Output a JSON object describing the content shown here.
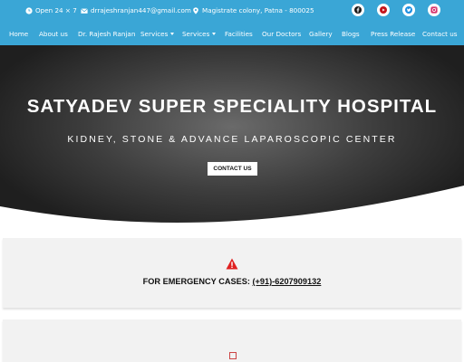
{
  "topbar": {
    "hours": "Open 24 × 7",
    "email": "drrajeshranjan447@gmail.com",
    "address": "Magistrate colony, Patna - 800025",
    "social_icons": [
      "facebook-icon",
      "youtube-icon",
      "twitter-icon",
      "instagram-icon"
    ],
    "brand_color": "#3aa6d6"
  },
  "nav": {
    "items": [
      {
        "label": "Home"
      },
      {
        "label": "About us"
      },
      {
        "label": "Dr. Rajesh Ranjan"
      },
      {
        "label": "Services",
        "dropdown": true
      },
      {
        "label": "Services",
        "dropdown": true
      },
      {
        "label": "Facilities"
      },
      {
        "label": "Our Doctors"
      },
      {
        "label": "Gallery"
      },
      {
        "label": "Blogs"
      },
      {
        "label": "Press Release"
      },
      {
        "label": "Contact us"
      }
    ]
  },
  "hero": {
    "title": "SATYADEV SUPER SPECIALITY HOSPITAL",
    "subtitle": "KIDNEY, STONE & ADVANCE LAPAROSCOPIC CENTER",
    "cta_label": "CONTACT US"
  },
  "emergency": {
    "label": "FOR EMERGENCY CASES:",
    "phone": "(+91)-6207909132",
    "icon": "warning-icon",
    "icon_color": "#e02020"
  }
}
